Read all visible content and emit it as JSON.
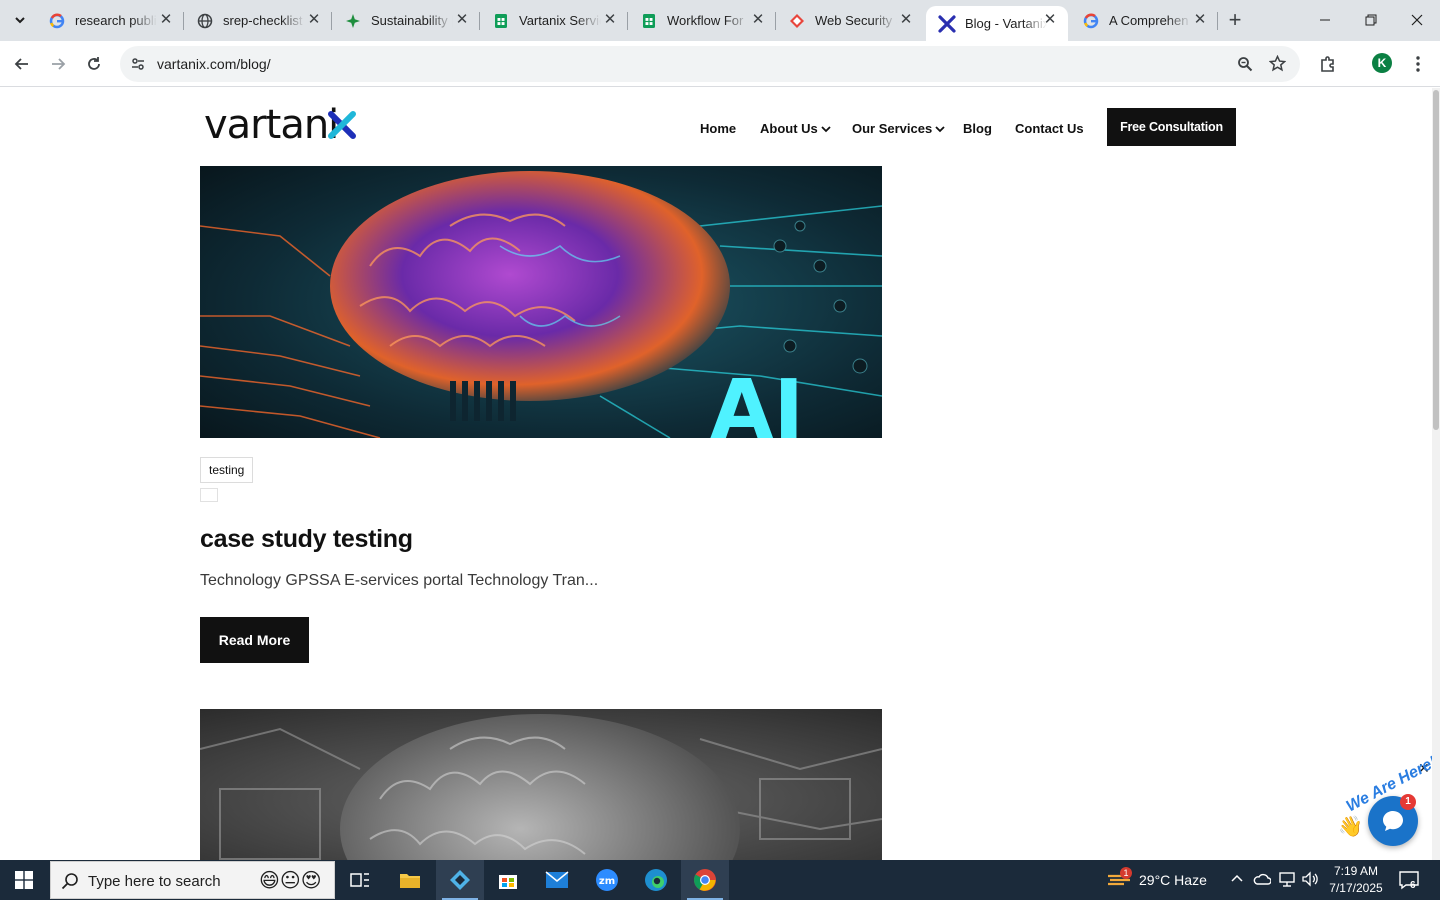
{
  "browser": {
    "tabs": [
      {
        "title": "research publi",
        "favicon": "google-g-icon"
      },
      {
        "title": "srep-checklist",
        "favicon": "globe-icon"
      },
      {
        "title": "Sustainability |",
        "favicon": "sparkle-icon"
      },
      {
        "title": "Vartanix Servic",
        "favicon": "sheets-icon"
      },
      {
        "title": "Workflow For",
        "favicon": "sheets-icon"
      },
      {
        "title": "Web Security S",
        "favicon": "diamond-icon"
      },
      {
        "title": "Blog - Vartanix",
        "favicon": "vartanix-x-icon",
        "active": true
      },
      {
        "title": "A Comprehen",
        "favicon": "google-g-icon"
      }
    ],
    "url": "vartanix.com/blog/",
    "profile_initial": "K"
  },
  "site": {
    "logo": "vartanix",
    "nav": {
      "home": "Home",
      "about": "About Us",
      "services": "Our Services",
      "blog": "Blog",
      "contact": "Contact Us"
    },
    "cta": "Free Consultation"
  },
  "post": {
    "image_text": "AI",
    "tag": "testing",
    "title": "case study testing",
    "excerpt": "Technology GPSSA E-services portal Technology Tran...",
    "read_more": "Read More"
  },
  "chat_widget": {
    "text": "We Are Here!",
    "badge": "1"
  },
  "taskbar": {
    "search_placeholder": "Type here to search",
    "weather_badge": "1",
    "weather": "29°C  Haze",
    "time": "7:19 AM",
    "date": "7/17/2025",
    "notifications": "6"
  },
  "colors": {
    "accent": "#111111",
    "chrome_tabstrip": "#dfe3e7",
    "taskbar": "#1b2a3a",
    "chat": "#1a73c9"
  }
}
